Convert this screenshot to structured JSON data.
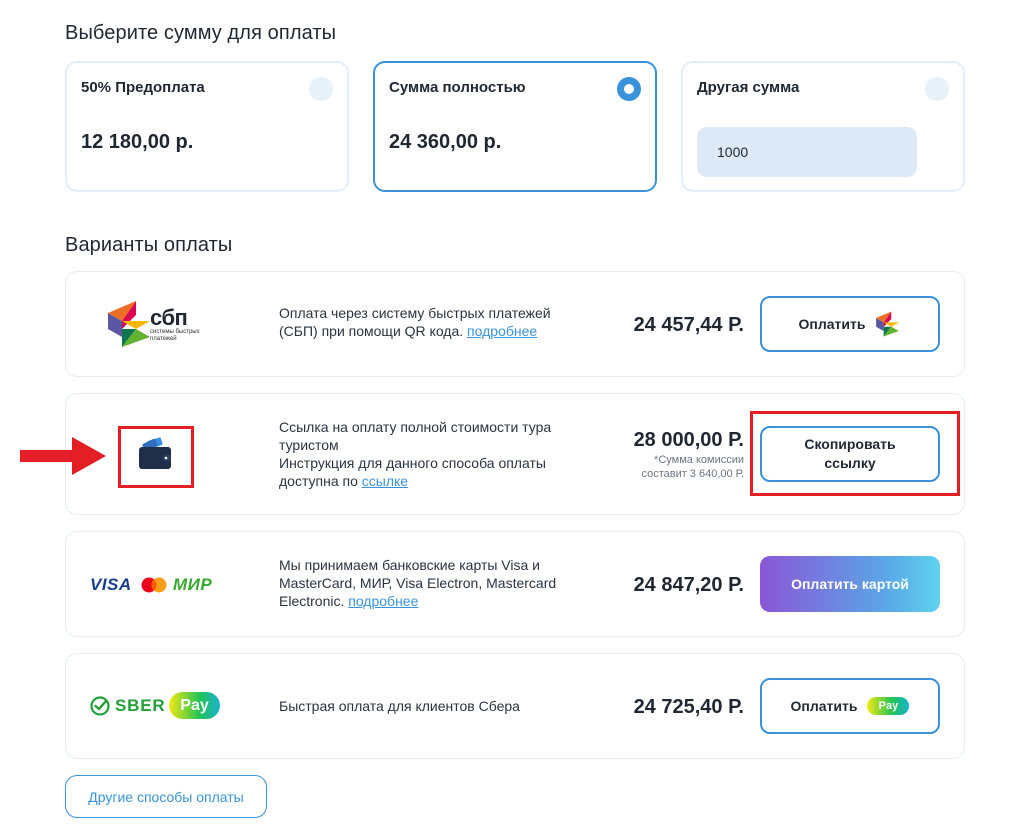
{
  "amount_section": {
    "heading": "Выберите сумму для оплаты",
    "options": [
      {
        "label": "50% Предоплата",
        "amount": "12 180,00 р.",
        "selected": false
      },
      {
        "label": "Сумма полностью",
        "amount": "24 360,00 р.",
        "selected": true
      },
      {
        "label": "Другая сумма",
        "input_value": "1000",
        "selected": false
      }
    ]
  },
  "methods_section": {
    "heading": "Варианты оплаты",
    "sbp": {
      "logo_text": "сбп",
      "logo_subtext": "системы быстрых платежей",
      "description": "Оплата через систему быстрых платежей (СБП) при помощи QR кода.",
      "link": "подробнее",
      "price": "24 457,44 Р.",
      "button": "Оплатить"
    },
    "link_pay": {
      "description_line1": "Ссылка на оплату полной стоимости тура туристом",
      "description_line2": "Инструкция для данного способа оплаты доступна по",
      "link": "ссылке",
      "price": "28 000,00 Р.",
      "note_line1": "*Сумма комиссии",
      "note_line2": "составит 3 640,00 Р.",
      "button_line1": "Скопировать",
      "button_line2": "ссылку"
    },
    "card": {
      "logos": [
        "VISA",
        "MIR"
      ],
      "mir_text": "МИР",
      "visa_text": "VISA",
      "description": "Мы принимаем банковские карты Visa и MasterCard, МИР, Visa Electron, Mastercard Electronic.",
      "link": "подробнее",
      "price": "24 847,20 Р.",
      "button": "Оплатить картой"
    },
    "sber": {
      "logo_text": "SBER",
      "logo_pay": "Pay",
      "description": "Быстрая оплата для клиентов Сбера",
      "price": "24 725,40 Р.",
      "button": "Оплатить",
      "button_badge": "Pay"
    },
    "other_button": "Другие способы оплаты"
  },
  "colors": {
    "accent": "#3a93da",
    "highlight": "#e31e24",
    "card_border": "#e3edf7"
  }
}
